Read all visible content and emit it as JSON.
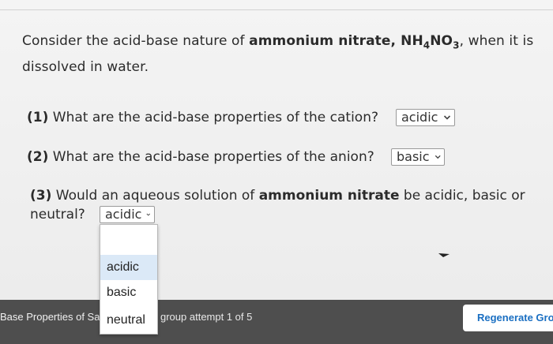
{
  "intro": {
    "text_a": "Consider the acid-base nature of ",
    "compound_name": "ammonium nitrate, NH",
    "sub1": "4",
    "compound_mid": "NO",
    "sub2": "3",
    "text_b": ", when it is dissolved in water."
  },
  "questions": [
    {
      "number": "(1)",
      "text": "What are the acid-base properties of the cation?",
      "selected": "acidic"
    },
    {
      "number": "(2)",
      "text": "What are the acid-base properties of the anion?",
      "selected": "basic"
    },
    {
      "number": "(3)",
      "text_a": "Would an aqueous solution of ",
      "bold": "ammonium nitrate",
      "text_b": " be acidic, basic or neutral?",
      "selected": "acidic"
    }
  ],
  "dropdown": {
    "options": [
      "acidic",
      "basic",
      "neutral"
    ],
    "highlighted": "acidic"
  },
  "footer": {
    "left_text": "Base Properties of Sa",
    "right_text": "group attempt 1 of 5",
    "button_label": "Regenerate Gro"
  },
  "colors": {
    "footer_bg": "#4e4e4e",
    "button_text": "#1a6fc2",
    "highlight": "#dbe9f7"
  }
}
